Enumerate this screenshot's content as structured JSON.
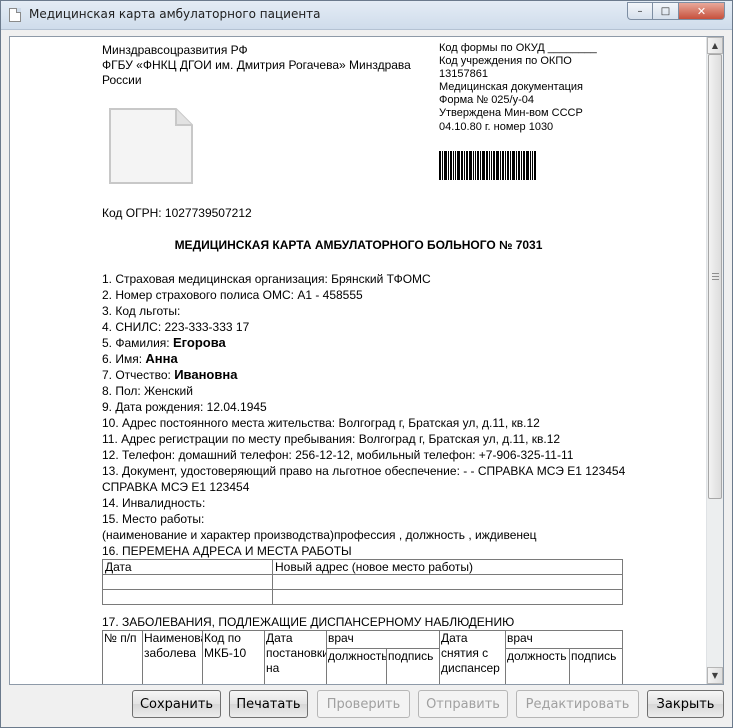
{
  "window": {
    "title": "Медицинская карта амбулаторного пациента",
    "min_glyph": "–",
    "max_glyph": "□",
    "close_glyph": "✕"
  },
  "header": {
    "left_line1": "Минздравсоцразвития РФ",
    "left_line2": "ФГБУ «ФНКЦ ДГОИ им. Дмитрия Рогачева» Минздрава",
    "left_line3": "России",
    "okud": "Код формы по ОКУД ________",
    "okpo": "Код учреждения по ОКПО",
    "okpo_code": "13157861",
    "doc_type": "Медицинская документация",
    "form": "Форма № 025/у-04",
    "approved": "Утверждена Мин-вом СССР",
    "approved_date": "04.10.80 г. номер 1030",
    "ogrn": "Код ОГРН: 1027739507212"
  },
  "title": "МЕДИЦИНСКАЯ КАРТА АМБУЛАТОРНОГО БОЛЬНОГО № 7031",
  "fields": {
    "f1": "1. Страховая медицинская организация: Брянский ТФОМС",
    "f2": "2. Номер страхового полиса ОМС: А1 - 458555",
    "f3": "3. Код льготы:",
    "f4": "4. СНИЛС: 223-333-333 17",
    "f5_label": "5. Фамилия: ",
    "f5_value": "Егорова",
    "f6_label": "6. Имя: ",
    "f6_value": "Анна",
    "f7_label": "7. Отчество: ",
    "f7_value": "Ивановна",
    "f8": "8. Пол: Женский",
    "f9": "9. Дата рождения: 12.04.1945",
    "f10": "10. Адрес постоянного места жительства: Волгоград г, Братская ул, д.11, кв.12",
    "f11": "11. Адрес регистрации по месту пребывания: Волгоград г, Братская ул, д.11, кв.12",
    "f12": "12. Телефон: домашний телефон: 256-12-12, мобильный телефон: +7-906-325-11-11",
    "f13": "13. Документ, удостоверяющий право на льготное обеспечение: - - СПРАВКА МСЭ Е1 123454 СПРАВКА МСЭ Е1 123454",
    "f14": "14. Инвалидность:",
    "f15": "15. Место работы:",
    "f15_note": "(наименование и характер производства)профессия , должность , иждивенец",
    "f16": "16. ПЕРЕМЕНА АДРЕСА И МЕСТА РАБОТЫ"
  },
  "table16": {
    "col_date": "Дата",
    "col_address": "Новый адрес (новое место работы)"
  },
  "table17": {
    "title": "17. ЗАБОЛЕВАНИЯ, ПОДЛЕЖАЩИЕ ДИСПАНСЕРНОМУ НАБЛЮДЕНИЮ",
    "c1": "№ п/п",
    "c2": "Наименование заболева",
    "c3": "Код по МКБ-10",
    "c4": "Дата постановки на",
    "c5": "врач",
    "c5a": "должность",
    "c5b": "подпись",
    "c6": "Дата снятия с диспансер",
    "c7": "врач",
    "c7a": "должность",
    "c7b": "подпись"
  },
  "scroll": {
    "up_glyph": "▲",
    "down_glyph": "▼"
  },
  "buttons": {
    "save": "Сохранить",
    "print": "Печатать",
    "check": "Проверить",
    "send": "Отправить",
    "edit": "Редактировать",
    "close": "Закрыть"
  }
}
